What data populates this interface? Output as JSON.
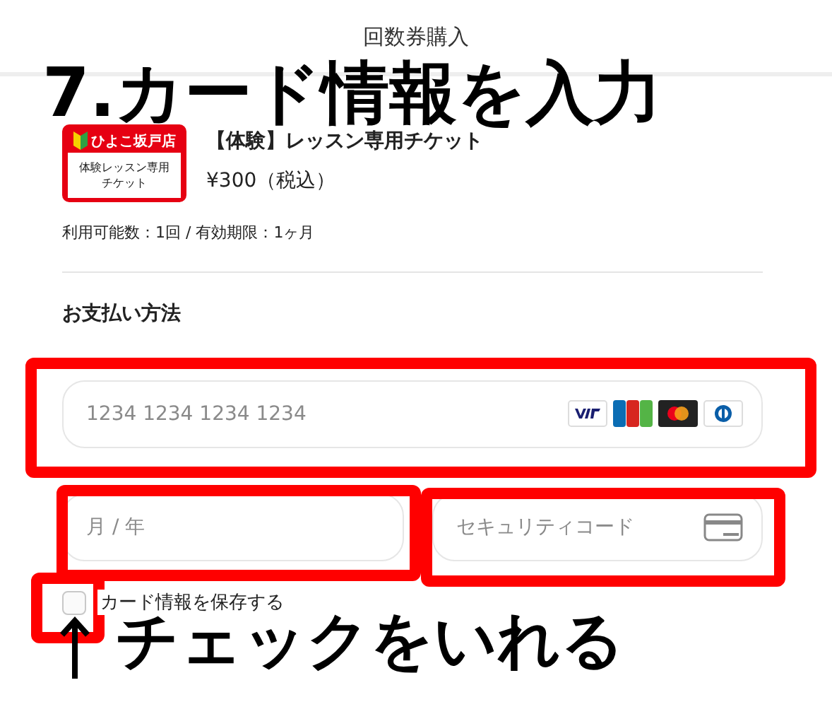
{
  "header": {
    "title": "回数券購入"
  },
  "ticket": {
    "logo_store": "ひよこ坂戸店",
    "logo_lines": [
      "体験レッスン専用",
      "チケット"
    ],
    "title": "【体験】レッスン専用チケット",
    "price": "¥300（税込）",
    "terms": "利用可能数：1回 / 有効期限：1ヶ月"
  },
  "payment": {
    "heading": "お支払い方法",
    "card_number": {
      "placeholder": "1234 1234 1234 1234"
    },
    "expiry": {
      "placeholder": "月 / 年"
    },
    "security_code": {
      "placeholder": "セキュリティコード"
    },
    "save_card": {
      "label": "カード情報を保存する",
      "checked": false
    }
  },
  "annotations": {
    "step_title": "7.カード情報を入力",
    "instruction": "チェックをいれる"
  }
}
